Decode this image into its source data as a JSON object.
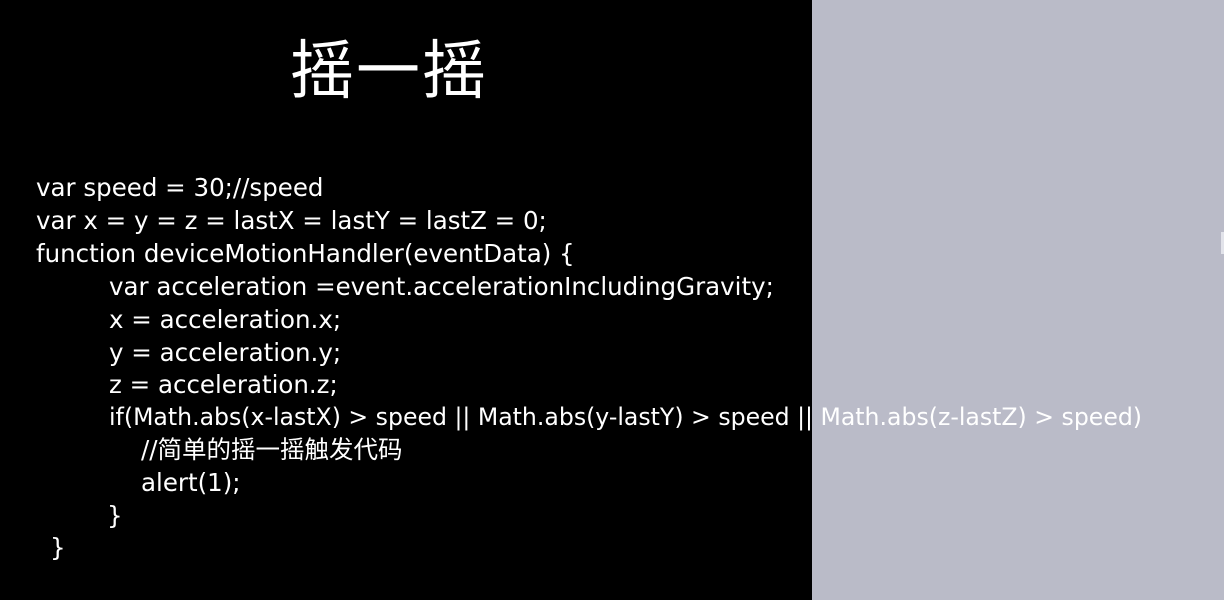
{
  "slide": {
    "title": "摇一摇",
    "code_lines": [
      "var speed = 30;//speed",
      "var x = y = z = lastX = lastY = lastZ = 0;",
      "function deviceMotionHandler(eventData) {",
      "var acceleration =event.accelerationIncludingGravity;",
      "x = acceleration.x;",
      "y = acceleration.y;",
      "z = acceleration.z;",
      "if(Math.abs(x-lastX) > speed || Math.abs(y-lastY) > speed || Math.abs(z-lastZ) > speed)",
      "//简单的摇一摇触发代码",
      "alert(1);",
      "}",
      "}"
    ]
  },
  "colors": {
    "slide_background": "#000000",
    "text": "#ffffff",
    "side_panel": "#babbc8"
  }
}
